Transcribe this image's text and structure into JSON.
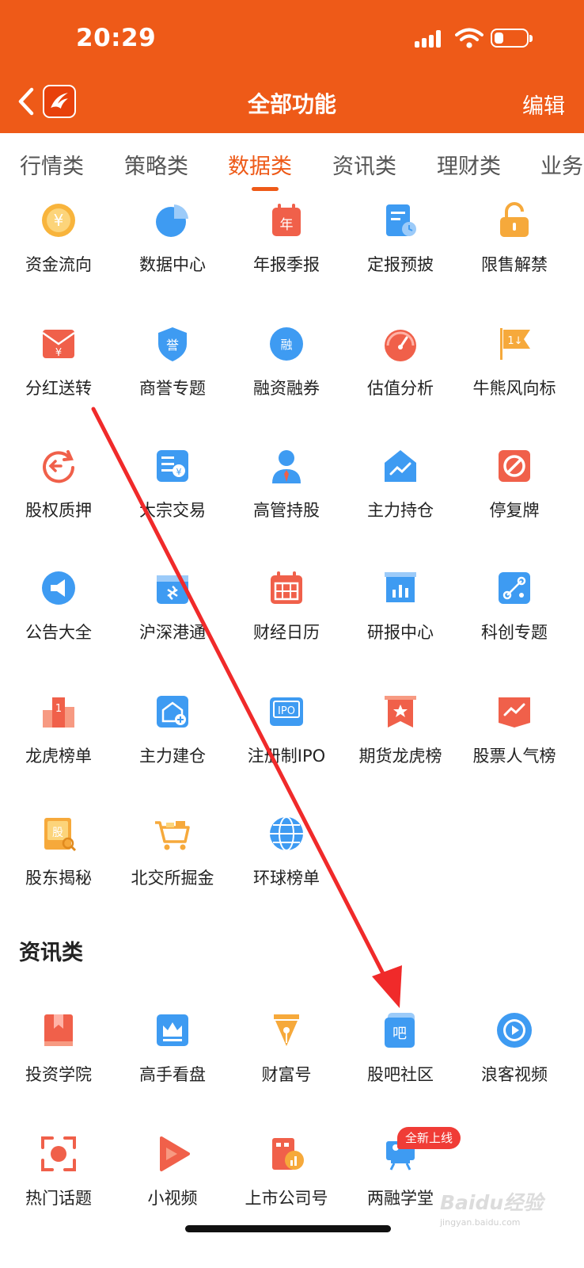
{
  "status_bar": {
    "time": "20:29"
  },
  "header": {
    "title": "全部功能",
    "edit_label": "编辑"
  },
  "tabs": [
    {
      "label": "行情类",
      "active": false
    },
    {
      "label": "策略类",
      "active": false
    },
    {
      "label": "数据类",
      "active": true
    },
    {
      "label": "资讯类",
      "active": false
    },
    {
      "label": "理财类",
      "active": false
    },
    {
      "label": "业务",
      "active": false
    }
  ],
  "data_items": [
    {
      "label": "资金流向",
      "icon": "yuan-coin-icon"
    },
    {
      "label": "数据中心",
      "icon": "pie-chart-icon"
    },
    {
      "label": "年报季报",
      "icon": "calendar-year-icon"
    },
    {
      "label": "定报预披",
      "icon": "document-clock-icon"
    },
    {
      "label": "限售解禁",
      "icon": "unlock-icon"
    },
    {
      "label": "分红送转",
      "icon": "red-envelope-icon"
    },
    {
      "label": "商誉专题",
      "icon": "shield-badge-icon"
    },
    {
      "label": "融资融券",
      "icon": "margin-circle-icon"
    },
    {
      "label": "估值分析",
      "icon": "gauge-icon"
    },
    {
      "label": "牛熊风向标",
      "icon": "flag-icon"
    },
    {
      "label": "股权质押",
      "icon": "pledge-refresh-icon"
    },
    {
      "label": "大宗交易",
      "icon": "bulk-trade-icon"
    },
    {
      "label": "高管持股",
      "icon": "executive-icon"
    },
    {
      "label": "主力持仓",
      "icon": "house-chart-icon"
    },
    {
      "label": "停复牌",
      "icon": "prohibit-icon"
    },
    {
      "label": "公告大全",
      "icon": "megaphone-icon"
    },
    {
      "label": "沪深港通",
      "icon": "hk-connect-icon"
    },
    {
      "label": "财经日历",
      "icon": "calendar-grid-icon"
    },
    {
      "label": "研报中心",
      "icon": "report-board-icon"
    },
    {
      "label": "科创专题",
      "icon": "tech-nodes-icon"
    },
    {
      "label": "龙虎榜单",
      "icon": "podium-icon"
    },
    {
      "label": "主力建仓",
      "icon": "house-add-icon"
    },
    {
      "label": "注册制IPO",
      "icon": "ipo-icon"
    },
    {
      "label": "期货龙虎榜",
      "icon": "star-banner-icon"
    },
    {
      "label": "股票人气榜",
      "icon": "trend-banner-icon"
    },
    {
      "label": "股东揭秘",
      "icon": "shareholder-book-icon"
    },
    {
      "label": "北交所掘金",
      "icon": "gold-cart-icon"
    },
    {
      "label": "环球榜单",
      "icon": "globe-icon"
    }
  ],
  "news_section": {
    "title": "资讯类",
    "items": [
      {
        "label": "投资学院",
        "icon": "bookmark-book-icon"
      },
      {
        "label": "高手看盘",
        "icon": "crown-screen-icon"
      },
      {
        "label": "财富号",
        "icon": "pen-nib-icon"
      },
      {
        "label": "股吧社区",
        "icon": "guba-icon"
      },
      {
        "label": "浪客视频",
        "icon": "play-circle-icon"
      },
      {
        "label": "热门话题",
        "icon": "focus-target-icon"
      },
      {
        "label": "小视频",
        "icon": "play-triangle-icon"
      },
      {
        "label": "上市公司号",
        "icon": "company-chart-icon"
      },
      {
        "label": "两融学堂",
        "icon": "lecture-icon"
      }
    ],
    "badge": "全新上线"
  },
  "watermark": {
    "brand": "Baidu经验",
    "url": "jingyan.baidu.com"
  },
  "colors": {
    "header_bg": "#EE5A18",
    "accent": "#EE5A18",
    "icon_red": "#F0604A",
    "icon_blue": "#3E9BF2",
    "icon_orange": "#F6A93B",
    "annotation_arrow": "#F02A2A",
    "badge_red": "#F03C36"
  }
}
